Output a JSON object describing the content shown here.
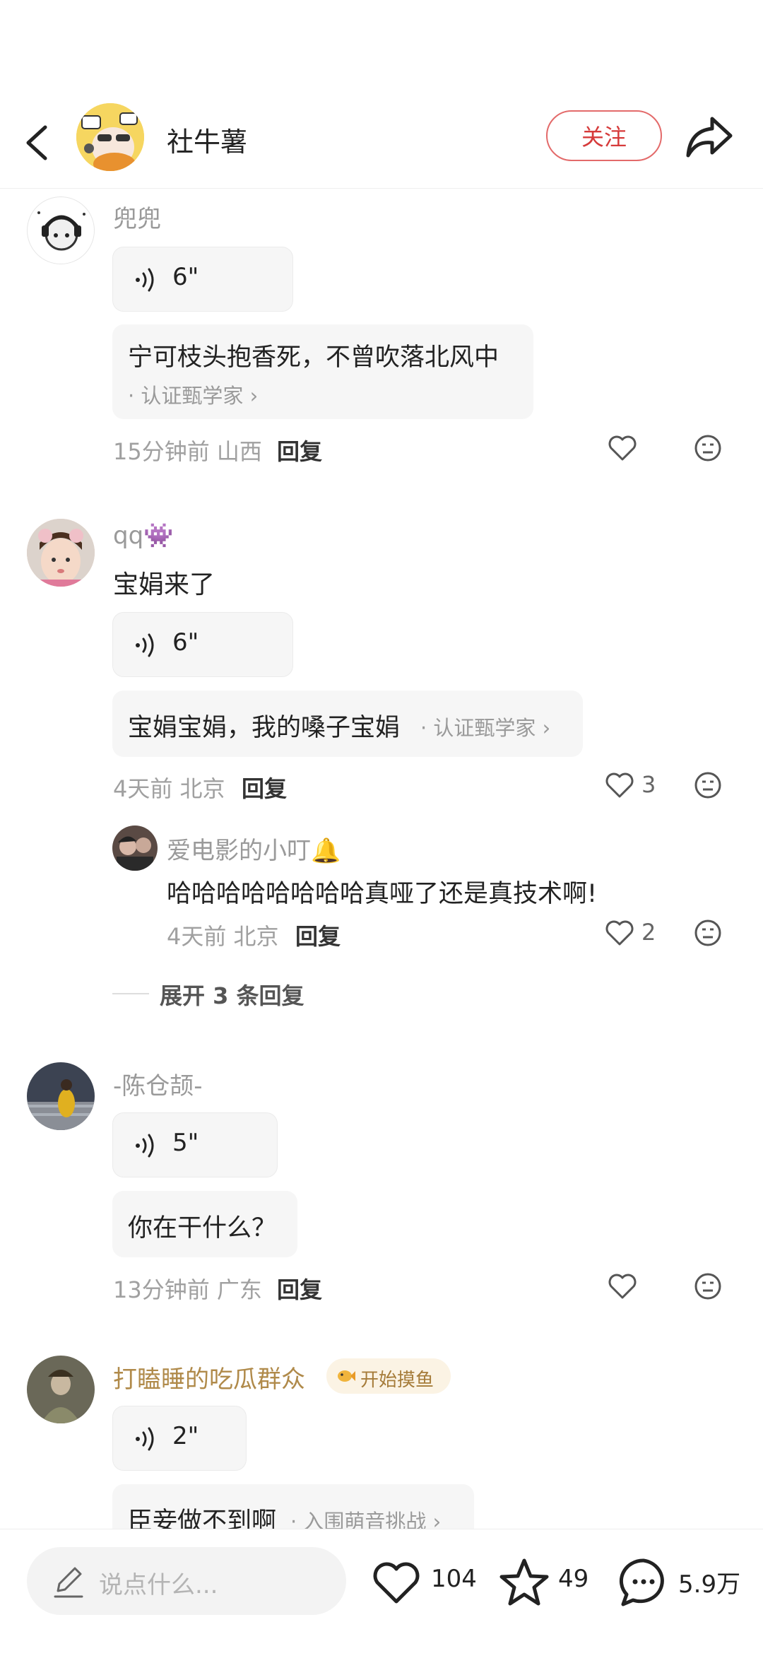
{
  "header": {
    "title": "社牛薯",
    "follow_label": "关注"
  },
  "comments": [
    {
      "username": "兜兜",
      "voice_duration": "6\"",
      "text": "宁可枝头抱香死，不曾吹落北风中",
      "tag": "· 认证甄学家 ›",
      "time_location": "15分钟前 山西",
      "reply_label": "回复"
    },
    {
      "username": "qq👾",
      "body_text": "宝娟来了",
      "voice_duration": "6\"",
      "text": "宝娟宝娟，我的嗓子宝娟",
      "tag": "· 认证甄学家 ›",
      "time_location": "4天前 北京",
      "reply_label": "回复",
      "like_count": "3",
      "replies": [
        {
          "username": "爱电影的小叮🔔",
          "text": "哈哈哈哈哈哈哈哈真哑了还是真技术啊!",
          "time_location": "4天前 北京",
          "reply_label": "回复",
          "like_count": "2"
        }
      ],
      "expand_label": "展开 3 条回复"
    },
    {
      "username": "-陈仓颉-",
      "voice_duration": "5\"",
      "text": "你在干什么？",
      "time_location": "13分钟前 广东",
      "reply_label": "回复"
    },
    {
      "username": "打瞌睡的吃瓜群众",
      "badge": "开始摸鱼",
      "voice_duration": "2\"",
      "text": "臣妾做不到啊",
      "tag": "· 入围萌音挑战 ›"
    }
  ],
  "bottom_bar": {
    "input_placeholder": "说点什么...",
    "like_count": "104",
    "star_count": "49",
    "comment_count": "5.9万"
  },
  "colors": {
    "accent": "#d63b3b",
    "username_gold": "#b08a4a",
    "badge_bg": "#fbf3e4"
  }
}
